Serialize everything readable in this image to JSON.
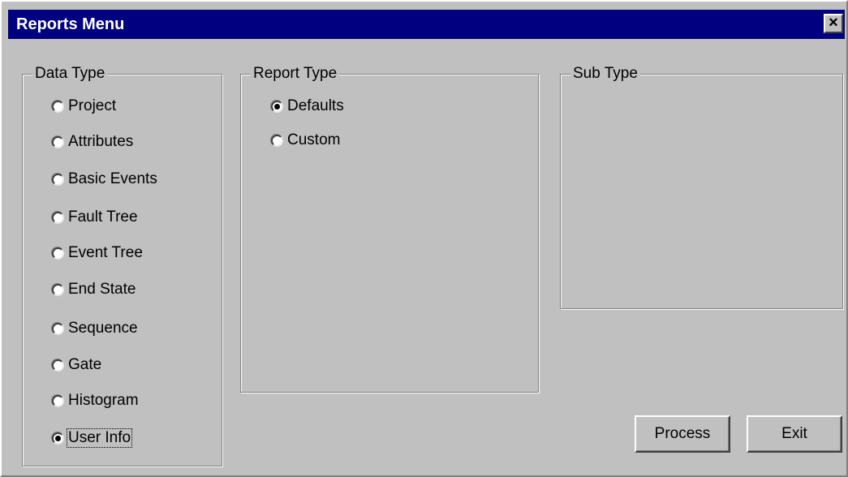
{
  "window": {
    "title": "Reports Menu",
    "close_label": "×"
  },
  "data_type": {
    "label": "Data Type",
    "selected": "User Info",
    "options": [
      {
        "label": "Project",
        "checked": false
      },
      {
        "label": "Attributes",
        "checked": false
      },
      {
        "label": "Basic Events",
        "checked": false
      },
      {
        "label": "Fault Tree",
        "checked": false
      },
      {
        "label": "Event Tree",
        "checked": false
      },
      {
        "label": "End State",
        "checked": false
      },
      {
        "label": "Sequence",
        "checked": false
      },
      {
        "label": "Gate",
        "checked": false
      },
      {
        "label": "Histogram",
        "checked": false
      },
      {
        "label": "User Info",
        "checked": true
      }
    ]
  },
  "report_type": {
    "label": "Report Type",
    "selected": "Defaults",
    "options": [
      {
        "label": "Defaults",
        "checked": true
      },
      {
        "label": "Custom",
        "checked": false
      }
    ]
  },
  "sub_type": {
    "label": "Sub Type"
  },
  "buttons": {
    "process_label": "Process",
    "exit_label": "Exit"
  },
  "colors": {
    "titlebar": "#000080",
    "face": "#c0c0c0"
  }
}
